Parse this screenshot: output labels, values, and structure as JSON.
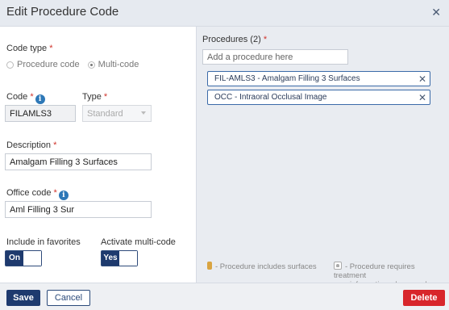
{
  "dialog": {
    "title": "Edit Procedure Code"
  },
  "code_type": {
    "label": "Code type",
    "options": [
      "Procedure code",
      "Multi-code"
    ],
    "selected": "Multi-code"
  },
  "code": {
    "label": "Code",
    "value": "FILAMLS3"
  },
  "type": {
    "label": "Type",
    "value": "Standard"
  },
  "description": {
    "label": "Description",
    "value": "Amalgam Filling 3 Surfaces"
  },
  "office_code": {
    "label": "Office code",
    "value": "Aml Filling 3 Sur"
  },
  "favorites": {
    "label": "Include in favorites",
    "state": "On"
  },
  "multicode": {
    "label": "Activate multi-code",
    "state": "Yes"
  },
  "procedures": {
    "label": "Procedures (2)",
    "placeholder": "Add a procedure here",
    "items": [
      "FIL-AMLS3 - Amalgam Filling 3 Surfaces",
      "OCC - Intraoral Occlusal Image"
    ]
  },
  "legend": {
    "surfaces": "- Procedure includes surfaces",
    "treatment_line1": "- Procedure requires treatment",
    "treatment_line2": "information when used"
  },
  "footer": {
    "save": "Save",
    "cancel": "Cancel",
    "delete": "Delete"
  },
  "colors": {
    "primary": "#1e3a6e",
    "danger": "#d8262b",
    "required": "#d0342c",
    "info": "#2e78b7",
    "surface_swatch": "#d9a441"
  }
}
